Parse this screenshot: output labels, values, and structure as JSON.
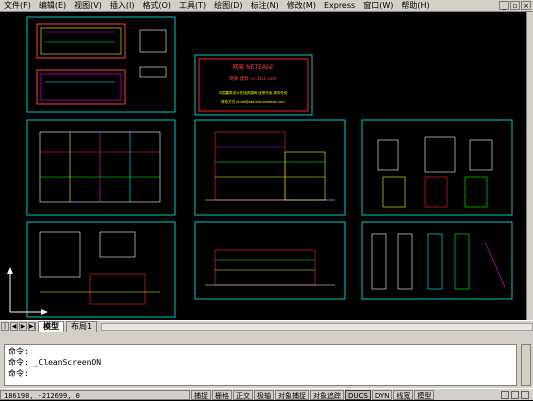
{
  "menubar": {
    "items": [
      "文件(F)",
      "编辑(E)",
      "视图(V)",
      "插入(I)",
      "格式(O)",
      "工具(T)",
      "绘图(D)",
      "标注(N)",
      "修改(M)",
      "Express",
      "窗口(W)",
      "帮助(H)"
    ]
  },
  "drawing": {
    "stamp_title": "网易  NETEASE",
    "stamp_subtitle": "网易·建筑  cn.163.com",
    "stamp_line1": "中国建筑设计在线资源网  优秀作品,请勿外传",
    "stamp_line2": "联系方式  build@abcline.netease.com"
  },
  "layout_tabs": [
    "模型",
    "布局1"
  ],
  "command": {
    "lines": [
      "命令:",
      "命令: _CleanScreenON",
      "命令:"
    ]
  },
  "status": {
    "coords": "186198, -212699, 0",
    "toggles": [
      {
        "label": "捕捉",
        "on": false
      },
      {
        "label": "栅格",
        "on": false
      },
      {
        "label": "正交",
        "on": false
      },
      {
        "label": "极轴",
        "on": false
      },
      {
        "label": "对象捕捉",
        "on": false
      },
      {
        "label": "对象追踪",
        "on": false
      },
      {
        "label": "DUCS",
        "on": true
      },
      {
        "label": "DYN",
        "on": false
      },
      {
        "label": "线宽",
        "on": false
      },
      {
        "label": "模型",
        "on": false
      }
    ]
  },
  "colors": {
    "canvas": "#000000",
    "frame": "#00c8c8",
    "accent": "#ff2020",
    "chrome": "#d4d0c8"
  }
}
